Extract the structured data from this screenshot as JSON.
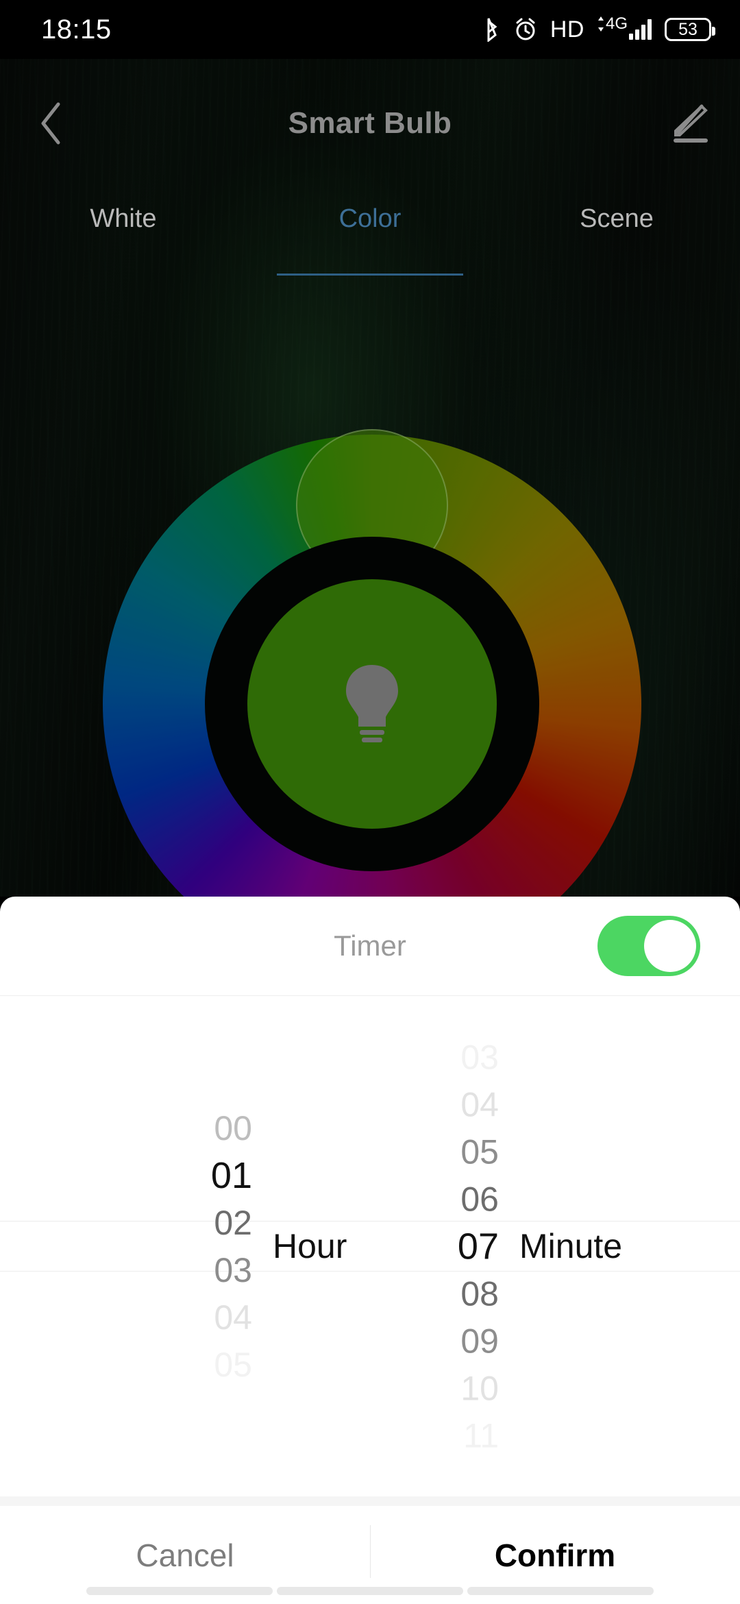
{
  "status_bar": {
    "time": "18:15",
    "icons": [
      "bluetooth-icon",
      "alarm-icon",
      "hd-icon",
      "signal-4g-icon",
      "battery-icon"
    ],
    "hd_label": "HD",
    "network_label": "4G",
    "battery_level": "53"
  },
  "header": {
    "title": "Smart Bulb",
    "back_icon": "chevron-left-icon",
    "edit_icon": "pencil-icon"
  },
  "tabs": [
    {
      "label": "White",
      "active": false
    },
    {
      "label": "Color",
      "active": true
    },
    {
      "label": "Scene",
      "active": false
    }
  ],
  "color_wheel": {
    "selected_color": "#2f6b06",
    "knob_color": "#3f7806",
    "center_icon": "bulb-icon",
    "accent_tab_color": "#3d6f97"
  },
  "timer_panel": {
    "label": "Timer",
    "toggle_on": true,
    "toggle_color": "#4cd662",
    "hour": {
      "unit": "Hour",
      "selected": "01",
      "values": [
        "00",
        "01",
        "02",
        "03",
        "04",
        "05"
      ]
    },
    "minute": {
      "unit": "Minute",
      "selected": "07",
      "values": [
        "03",
        "04",
        "05",
        "06",
        "07",
        "08",
        "09",
        "10",
        "11"
      ]
    }
  },
  "footer": {
    "cancel_label": "Cancel",
    "confirm_label": "Confirm"
  }
}
